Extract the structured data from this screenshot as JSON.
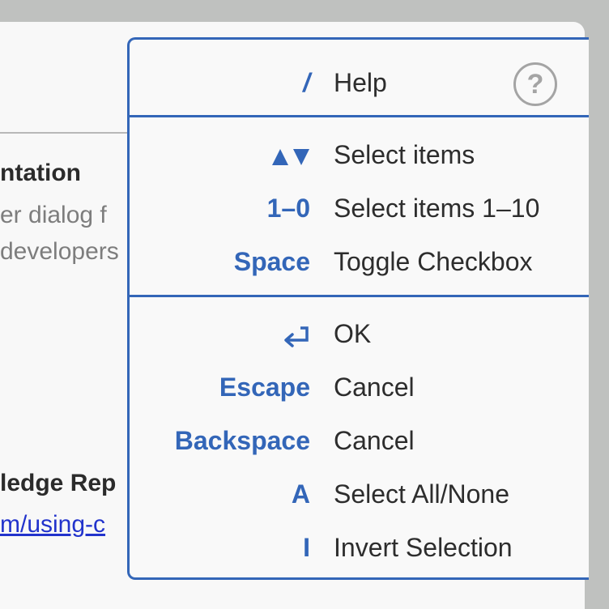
{
  "background": {
    "heading": "ntation",
    "description_line1": "er dialog f",
    "description_line2": "developers",
    "heading2": "ledge Rep",
    "link": "m/using-c"
  },
  "help_row": {
    "key": "/",
    "label": "Help",
    "help_button": "?"
  },
  "sections": {
    "selection": [
      {
        "key": "▲▼",
        "label": "Select items"
      },
      {
        "key": "1–0",
        "label": "Select items 1–10"
      },
      {
        "key": "Space",
        "label": "Toggle Checkbox"
      }
    ],
    "actions": [
      {
        "key": "return-icon",
        "label": "OK"
      },
      {
        "key": "Escape",
        "label": "Cancel"
      },
      {
        "key": "Backspace",
        "label": "Cancel"
      },
      {
        "key": "A",
        "label": "Select All/None"
      },
      {
        "key": "I",
        "label": "Invert Selection"
      }
    ]
  },
  "colors": {
    "accent": "#3366b8",
    "text": "#2d2d2d",
    "link": "#2233cc",
    "muted": "#a4a4a4"
  }
}
